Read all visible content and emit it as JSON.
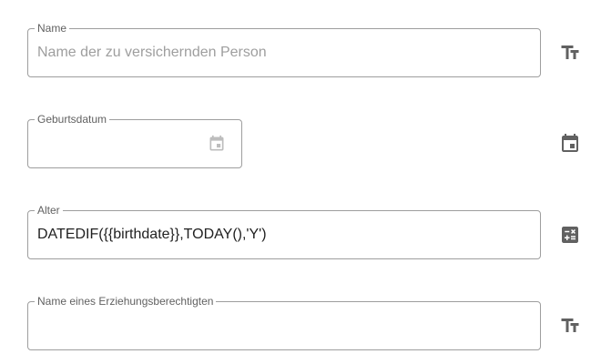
{
  "fields": [
    {
      "label": "Name",
      "value": "",
      "placeholder": "Name der zu versichernden Person",
      "type_icon": "text-fields-icon"
    },
    {
      "label": "Geburtsdatum",
      "value": "",
      "placeholder": "",
      "type_icon": "calendar-icon",
      "picker_icon": "calendar-picker-icon"
    },
    {
      "label": "Alter",
      "value": "DATEDIF({{birthdate}},TODAY(),'Y')",
      "placeholder": "",
      "type_icon": "calculate-icon"
    },
    {
      "label": "Name eines Erziehungsberechtigten",
      "value": "",
      "placeholder": "",
      "type_icon": "text-fields-icon"
    }
  ],
  "colors": {
    "border": "#9e9e9e",
    "label": "#616161",
    "icon": "#616161",
    "text": "#212121",
    "placeholder": "#9e9e9e"
  }
}
